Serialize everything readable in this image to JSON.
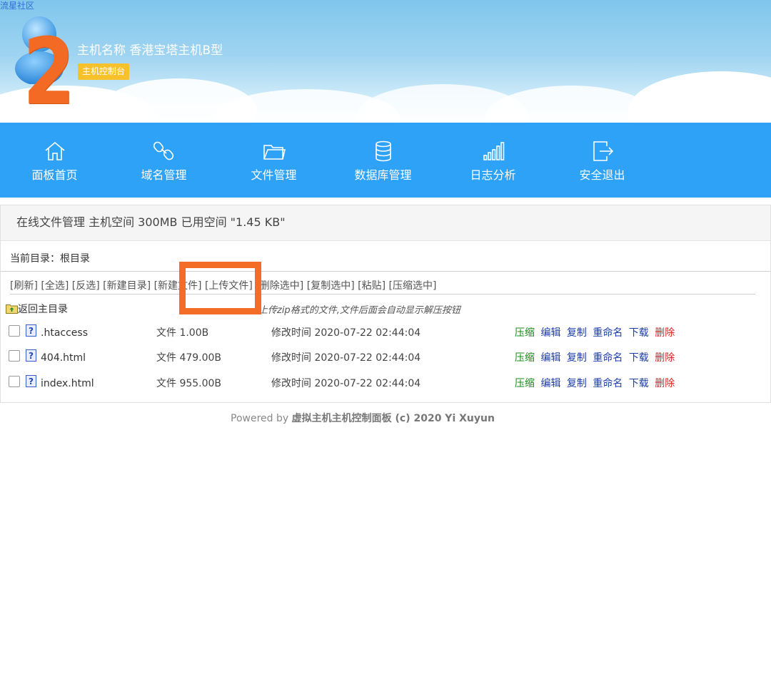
{
  "header": {
    "site_link": "流星社区",
    "big_number": "2",
    "host_name": "主机名称 香港宝塔主机B型",
    "host_badge": "主机控制台"
  },
  "nav": {
    "items": [
      {
        "label": "面板首页",
        "icon": "home-icon"
      },
      {
        "label": "域名管理",
        "icon": "link-icon"
      },
      {
        "label": "文件管理",
        "icon": "folder-icon"
      },
      {
        "label": "数据库管理",
        "icon": "database-icon"
      },
      {
        "label": "日志分析",
        "icon": "signal-bars-icon"
      },
      {
        "label": "安全退出",
        "icon": "logout-icon"
      }
    ]
  },
  "panel": {
    "title": "在线文件管理 主机空间 300MB 已用空间 \"1.45 KB\"",
    "current_dir": "当前目录：根目录",
    "toolbar": {
      "refresh": "[刷新]",
      "select_all": "[全选]",
      "invert": "[反选]",
      "new_dir": "[新建目录]",
      "new_file": "[新建文件]",
      "upload": "[上传文件]",
      "delete_selected": "[删除选中]",
      "copy_selected": "[复制选中]",
      "paste": "[粘贴]",
      "compress_selected": "[压缩选中]"
    },
    "back_label": "返回主目录",
    "hint": "上传zip格式的文件,文件后面会自动显示解压按钮",
    "files": [
      {
        "name": ".htaccess",
        "size": "文件 1.00B",
        "modified": "修改时间 2020-07-22 02:44:04"
      },
      {
        "name": "404.html",
        "size": "文件 479.00B",
        "modified": "修改时间 2020-07-22 02:44:04"
      },
      {
        "name": "index.html",
        "size": "文件 955.00B",
        "modified": "修改时间 2020-07-22 02:44:04"
      }
    ],
    "ops": {
      "compress": "压缩",
      "edit": "编辑",
      "copy": "复制",
      "rename": "重命名",
      "download": "下载",
      "delete": "删除"
    }
  },
  "footer": {
    "prefix": "Powered by ",
    "product": "虚拟主机主机控制面板",
    "suffix": " (c) 2020 Yi Xuyun"
  },
  "colors": {
    "nav_bg": "#2ea2f7",
    "highlight": "#f36d26",
    "badge": "#f6c12b",
    "op_compress": "#1a8a1a",
    "op_link": "#1d3ea8",
    "op_delete": "#e02020"
  }
}
